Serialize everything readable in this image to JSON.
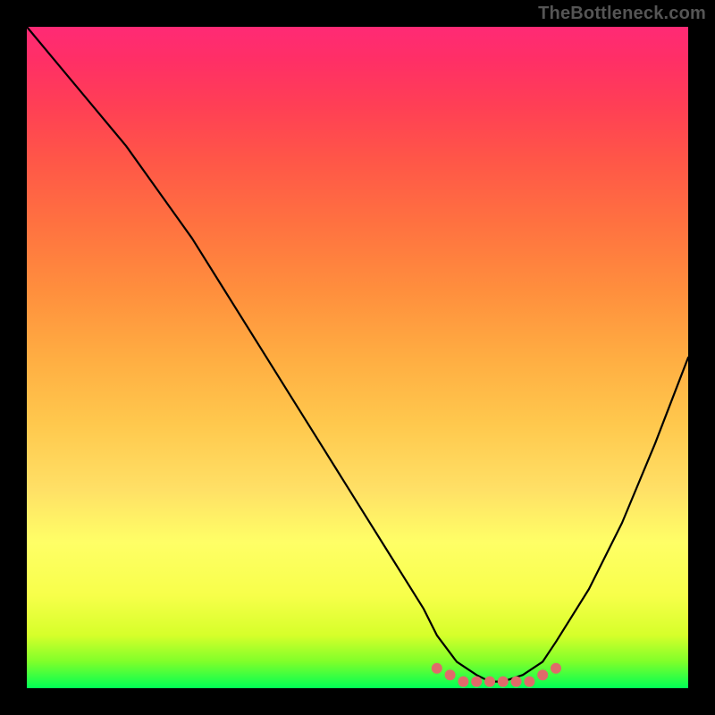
{
  "watermark": "TheBottleneck.com",
  "chart_data": {
    "type": "line",
    "title": "",
    "xlabel": "",
    "ylabel": "",
    "xlim": [
      0,
      100
    ],
    "ylim": [
      0,
      100
    ],
    "grid": false,
    "legend": false,
    "series": [
      {
        "name": "curve",
        "color": "#000000",
        "x": [
          0,
          5,
          10,
          15,
          20,
          25,
          30,
          35,
          40,
          45,
          50,
          55,
          60,
          62,
          65,
          68,
          70,
          72,
          75,
          78,
          80,
          85,
          90,
          95,
          100
        ],
        "values": [
          100,
          94,
          88,
          82,
          75,
          68,
          60,
          52,
          44,
          36,
          28,
          20,
          12,
          8,
          4,
          2,
          1,
          1,
          2,
          4,
          7,
          15,
          25,
          37,
          50
        ]
      },
      {
        "name": "bottom-dots",
        "color": "#e06a6a",
        "x": [
          62,
          64,
          66,
          68,
          70,
          72,
          74,
          76,
          78,
          80
        ],
        "values": [
          3,
          2,
          1,
          1,
          1,
          1,
          1,
          1,
          2,
          3
        ]
      }
    ]
  }
}
